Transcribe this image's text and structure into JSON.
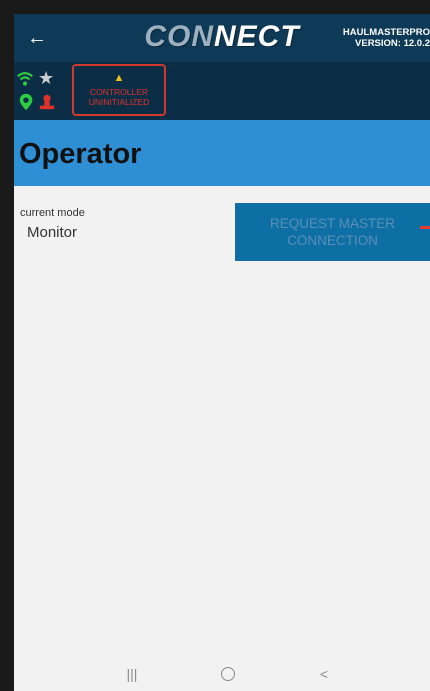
{
  "header": {
    "logo_part1": "CON",
    "logo_part2": "NECT",
    "device_name": "HAULMASTERPRO",
    "version": "VERSION: 12.0.2"
  },
  "status": {
    "icons": [
      "wifi-icon",
      "star-icon",
      "location-pin-icon",
      "user-icon"
    ],
    "controller_line1": "CONTROLLER",
    "controller_line2": "UNINITIALIZED",
    "colors": {
      "wifi": "#2ecc40",
      "pin": "#2ecc40",
      "user": "#e0322b",
      "warning": "#f2c01e"
    }
  },
  "page": {
    "title": "Operator"
  },
  "mode": {
    "label": "current mode",
    "value": "Monitor"
  },
  "request_button": {
    "line1": "REQUEST MASTER",
    "line2": "CONNECTION"
  },
  "navbar": {
    "recent": "|||",
    "back": "<"
  },
  "colors": {
    "header_bg": "#0f3a57",
    "status_bg": "#0b2d45",
    "title_band": "#2f8fd5",
    "button_bg": "#0e6fa5",
    "alert": "#d23a2b"
  }
}
